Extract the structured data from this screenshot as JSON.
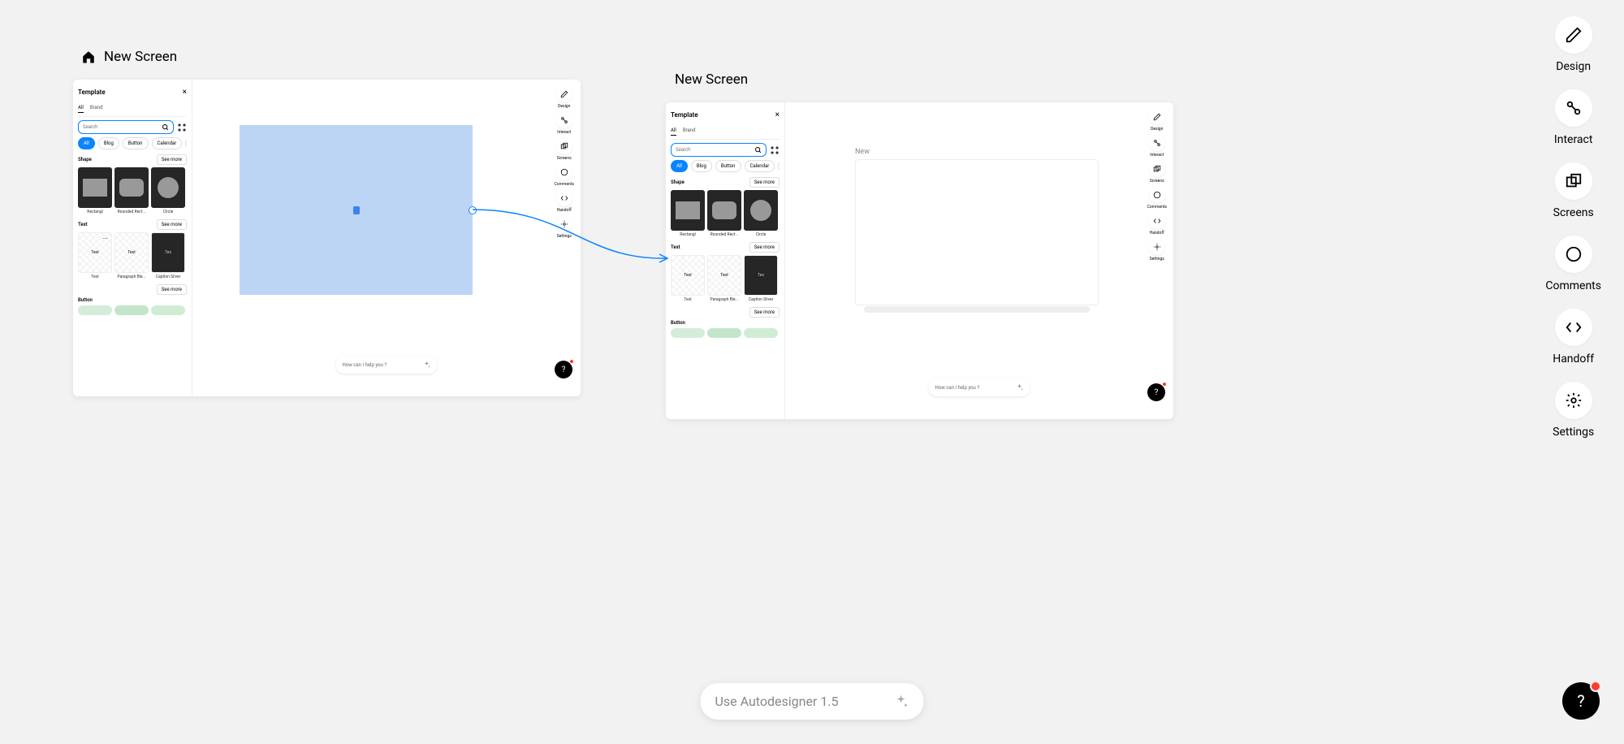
{
  "screens": {
    "screen1": {
      "title": "New Screen"
    },
    "screen2": {
      "title": "New Screen"
    }
  },
  "template_panel": {
    "title": "Template",
    "tabs": {
      "all": "All",
      "brand": "Brand"
    },
    "search_placeholder": "Search",
    "chips": {
      "all": "All",
      "blog": "Blog",
      "button": "Button",
      "calendar": "Calendar",
      "more": "C"
    },
    "sections": {
      "shape": {
        "label": "Shape",
        "see_more": "See more",
        "items": {
          "rectangle": "Rectangl",
          "rounded": "Rounded Rect ..",
          "circle": "Circle"
        }
      },
      "text": {
        "label": "Text",
        "see_more": "See more",
        "items": {
          "t1": "Text",
          "t2": "Text",
          "t3": "Tex",
          "l1": "Text",
          "l2": "Paragraph Bla ..",
          "l3": "Caption Silver"
        }
      },
      "button": {
        "label": "Button",
        "see_more": "See more"
      }
    }
  },
  "mini_tools": {
    "design": "Design",
    "interact": "Interact",
    "screens": "Screens",
    "comments": "Comments",
    "handoff": "Handoff",
    "settings": "Settings"
  },
  "right_tools": {
    "design": "Design",
    "interact": "Interact",
    "screens": "Screens",
    "comments": "Comments",
    "handoff": "Handoff",
    "settings": "Settings"
  },
  "prompt": {
    "placeholder": "How can I help you ?"
  },
  "autodesigner": {
    "label": "Use Autodesigner 1.5"
  },
  "help": {
    "label": "?"
  },
  "screen2_partial": "New"
}
